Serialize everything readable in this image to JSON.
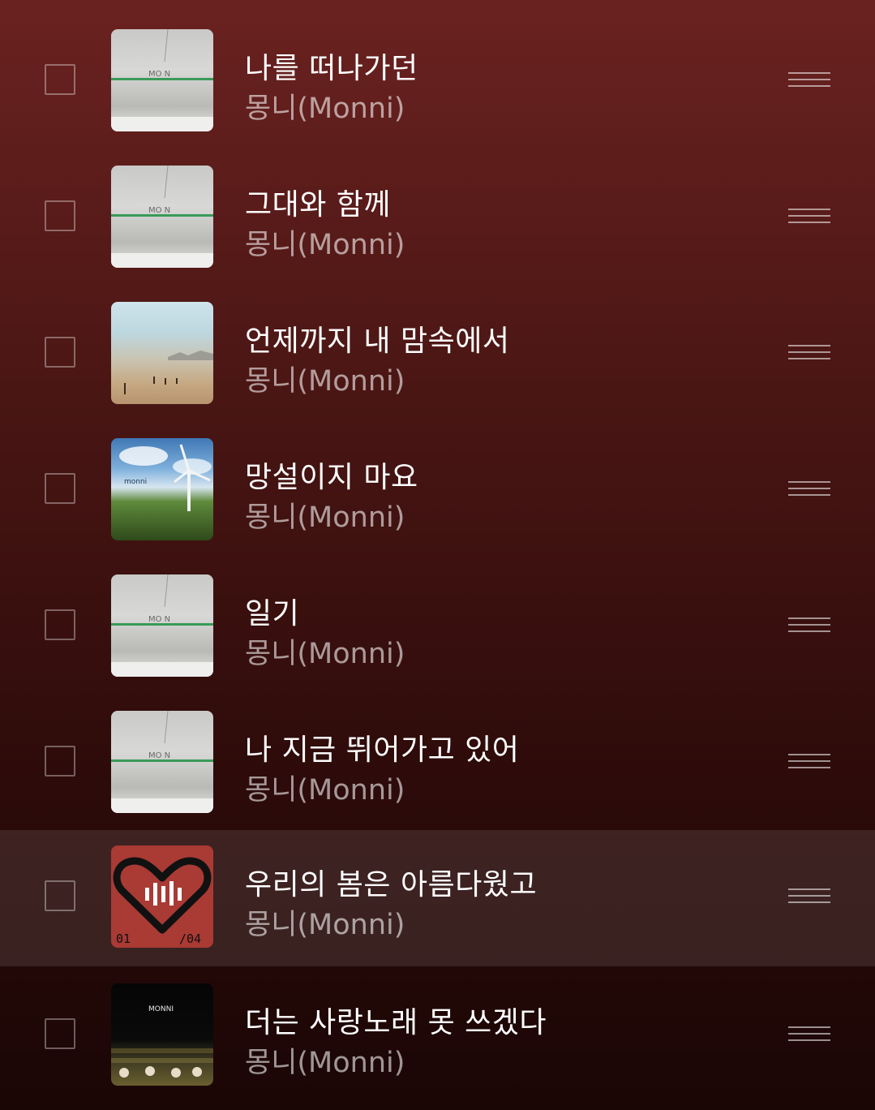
{
  "tracks": [
    {
      "title": "나를 떠나가던",
      "artist": "몽니(Monni)",
      "art": "concrete",
      "art_text": "MO N"
    },
    {
      "title": "그대와 함께",
      "artist": "몽니(Monni)",
      "art": "concrete",
      "art_text": "MO N"
    },
    {
      "title": "언제까지 내 맘속에서",
      "artist": "몽니(Monni)",
      "art": "desert",
      "art_text": ""
    },
    {
      "title": "망설이지 마요",
      "artist": "몽니(Monni)",
      "art": "windmill",
      "art_text": "monni"
    },
    {
      "title": "일기",
      "artist": "몽니(Monni)",
      "art": "concrete",
      "art_text": "MO N"
    },
    {
      "title": "나 지금 뛰어가고 있어",
      "artist": "몽니(Monni)",
      "art": "concrete",
      "art_text": "MO N"
    },
    {
      "title": "우리의 봄은 아름다웠고",
      "artist": "몽니(Monni)",
      "art": "heart",
      "art_text_left": "01",
      "art_text_right": "/04",
      "active": true
    },
    {
      "title": "더는 사랑노래 못 쓰겠다",
      "artist": "몽니(Monni)",
      "art": "monni",
      "art_text": "MONNI"
    }
  ],
  "colors": {
    "bg_top": "#6a2220",
    "bg_bottom": "#1a0605",
    "heart_art": "#a93a34"
  },
  "icons": {
    "checkbox": "checkbox-icon",
    "drag_handle": "drag-handle-icon"
  }
}
